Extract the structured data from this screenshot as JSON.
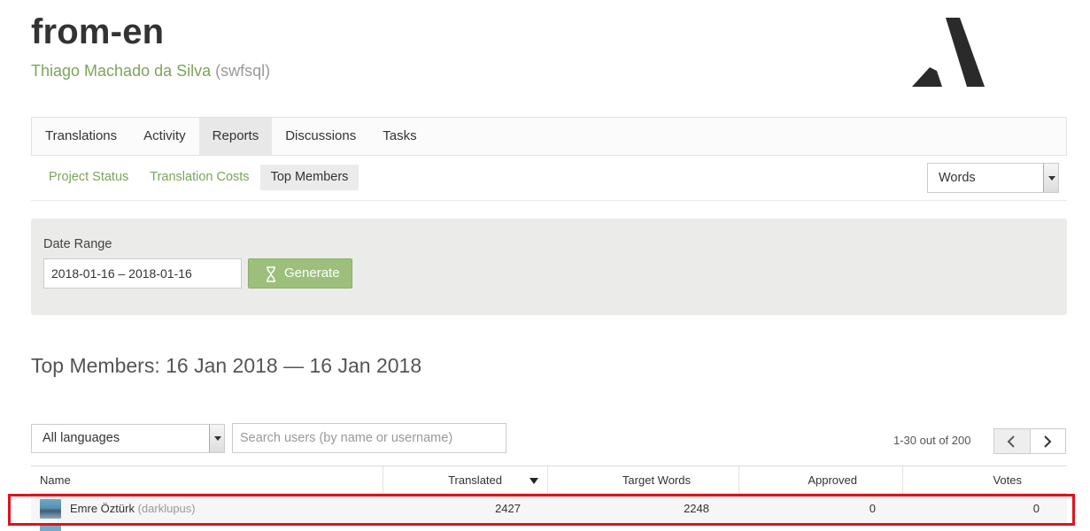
{
  "project": {
    "title": "from-en",
    "owner_name": "Thiago Machado da Silva",
    "owner_username": "(swfsql)"
  },
  "tabs": [
    {
      "label": "Translations",
      "active": false
    },
    {
      "label": "Activity",
      "active": false
    },
    {
      "label": "Reports",
      "active": true
    },
    {
      "label": "Discussions",
      "active": false
    },
    {
      "label": "Tasks",
      "active": false
    }
  ],
  "subtabs": [
    {
      "label": "Project Status",
      "active": false
    },
    {
      "label": "Translation Costs",
      "active": false
    },
    {
      "label": "Top Members",
      "active": true
    }
  ],
  "units_select": {
    "value": "Words"
  },
  "filter": {
    "label": "Date Range",
    "date_value": "2018-01-16 – 2018-01-16",
    "generate_label": "Generate"
  },
  "section_title": "Top Members: 16 Jan 2018 — 16 Jan 2018",
  "language_select": {
    "value": "All languages"
  },
  "search": {
    "placeholder": "Search users (by name or username)"
  },
  "pagination": {
    "text": "1-30 out of 200"
  },
  "table": {
    "columns": [
      "Name",
      "Translated",
      "Target Words",
      "Approved",
      "Votes"
    ],
    "sorted_column": "Translated",
    "rows": [
      {
        "name": "Emre Öztürk",
        "username": "(darklupus)",
        "translated": "2427",
        "target_words": "2248",
        "approved": "0",
        "votes": "0"
      }
    ]
  },
  "colors": {
    "accent_green": "#7ca45a",
    "generate_button": "#9cc07c",
    "highlight_border": "#e0121a"
  }
}
